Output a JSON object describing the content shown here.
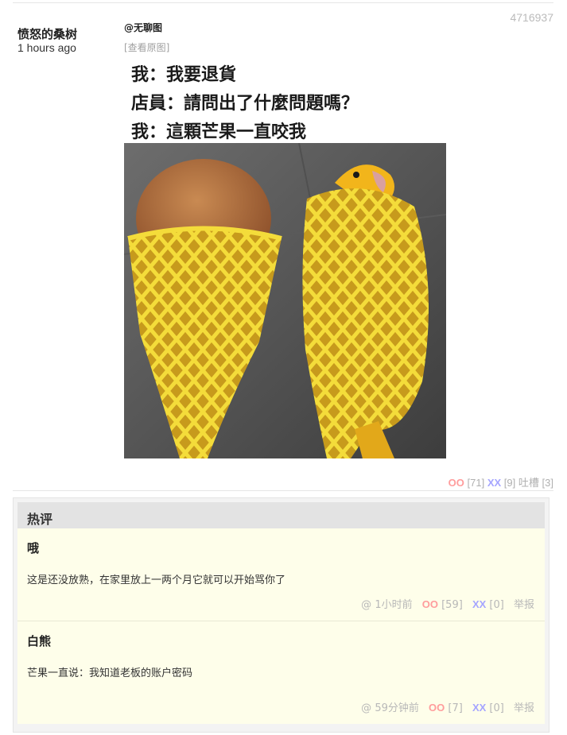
{
  "post": {
    "id": "4716937",
    "author": "愤怒的桑树",
    "time": "1 hours ago",
    "mention": "@无聊图",
    "view_original": "[查看原图]",
    "caption_lines": [
      "我：我要退貨",
      "店員：請問出了什麼問題嗎？",
      "我：這顆芒果一直咬我"
    ],
    "votes": {
      "oo_label": "OO",
      "oo_count": "[71]",
      "xx_label": "XX",
      "xx_count": "[9]",
      "tucao_label": "吐槽",
      "tucao_count": "[3]"
    }
  },
  "hot_comments": {
    "title": "热评",
    "items": [
      {
        "author": "哦",
        "text": "这是还没放熟，在家里放上一两个月它就可以开始骂你了",
        "at": "@",
        "time": "1小时前",
        "oo_label": "OO",
        "oo_count": "[59]",
        "xx_label": "XX",
        "xx_count": "[0]",
        "report": "举报"
      },
      {
        "author": "白熊",
        "text": "芒果一直说：我知道老板的账户密码",
        "at": "@",
        "time": "59分钟前",
        "oo_label": "OO",
        "oo_count": "[7]",
        "xx_label": "XX",
        "xx_count": "[0]",
        "report": "举报"
      }
    ]
  },
  "colors": {
    "oo": "#ff9c9c",
    "xx": "#a5a5ff",
    "comment_bg": "#fefeea",
    "hot_title_bg": "#e3e3e3"
  }
}
